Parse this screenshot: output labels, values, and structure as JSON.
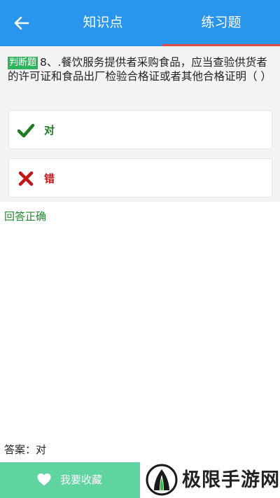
{
  "header": {
    "tabs": [
      {
        "label": "知识点"
      },
      {
        "label": "练习题"
      }
    ],
    "active_tab_index": 1,
    "back_icon": "arrow-left-icon",
    "color": "#2a95ec",
    "underline_color": "#e04a43"
  },
  "question": {
    "tag": "判断题",
    "text": "8、.餐饮服务提供者采购食品，应当查验供货者的许可证和食品出厂检验合格证或者其他合格证明（                   ）"
  },
  "options": [
    {
      "label": "对",
      "icon": "check-icon",
      "color": "#1e7d24"
    },
    {
      "label": "错",
      "icon": "cross-icon",
      "color": "#c31616"
    }
  ],
  "result_text": "回答正确",
  "answer_text": "答案：对",
  "bottom": {
    "favorite_label": "我要收藏",
    "favorite_icon": "heart-icon",
    "favorite_color": "#5fd3a0"
  },
  "watermark": {
    "text": "极限手游网"
  }
}
